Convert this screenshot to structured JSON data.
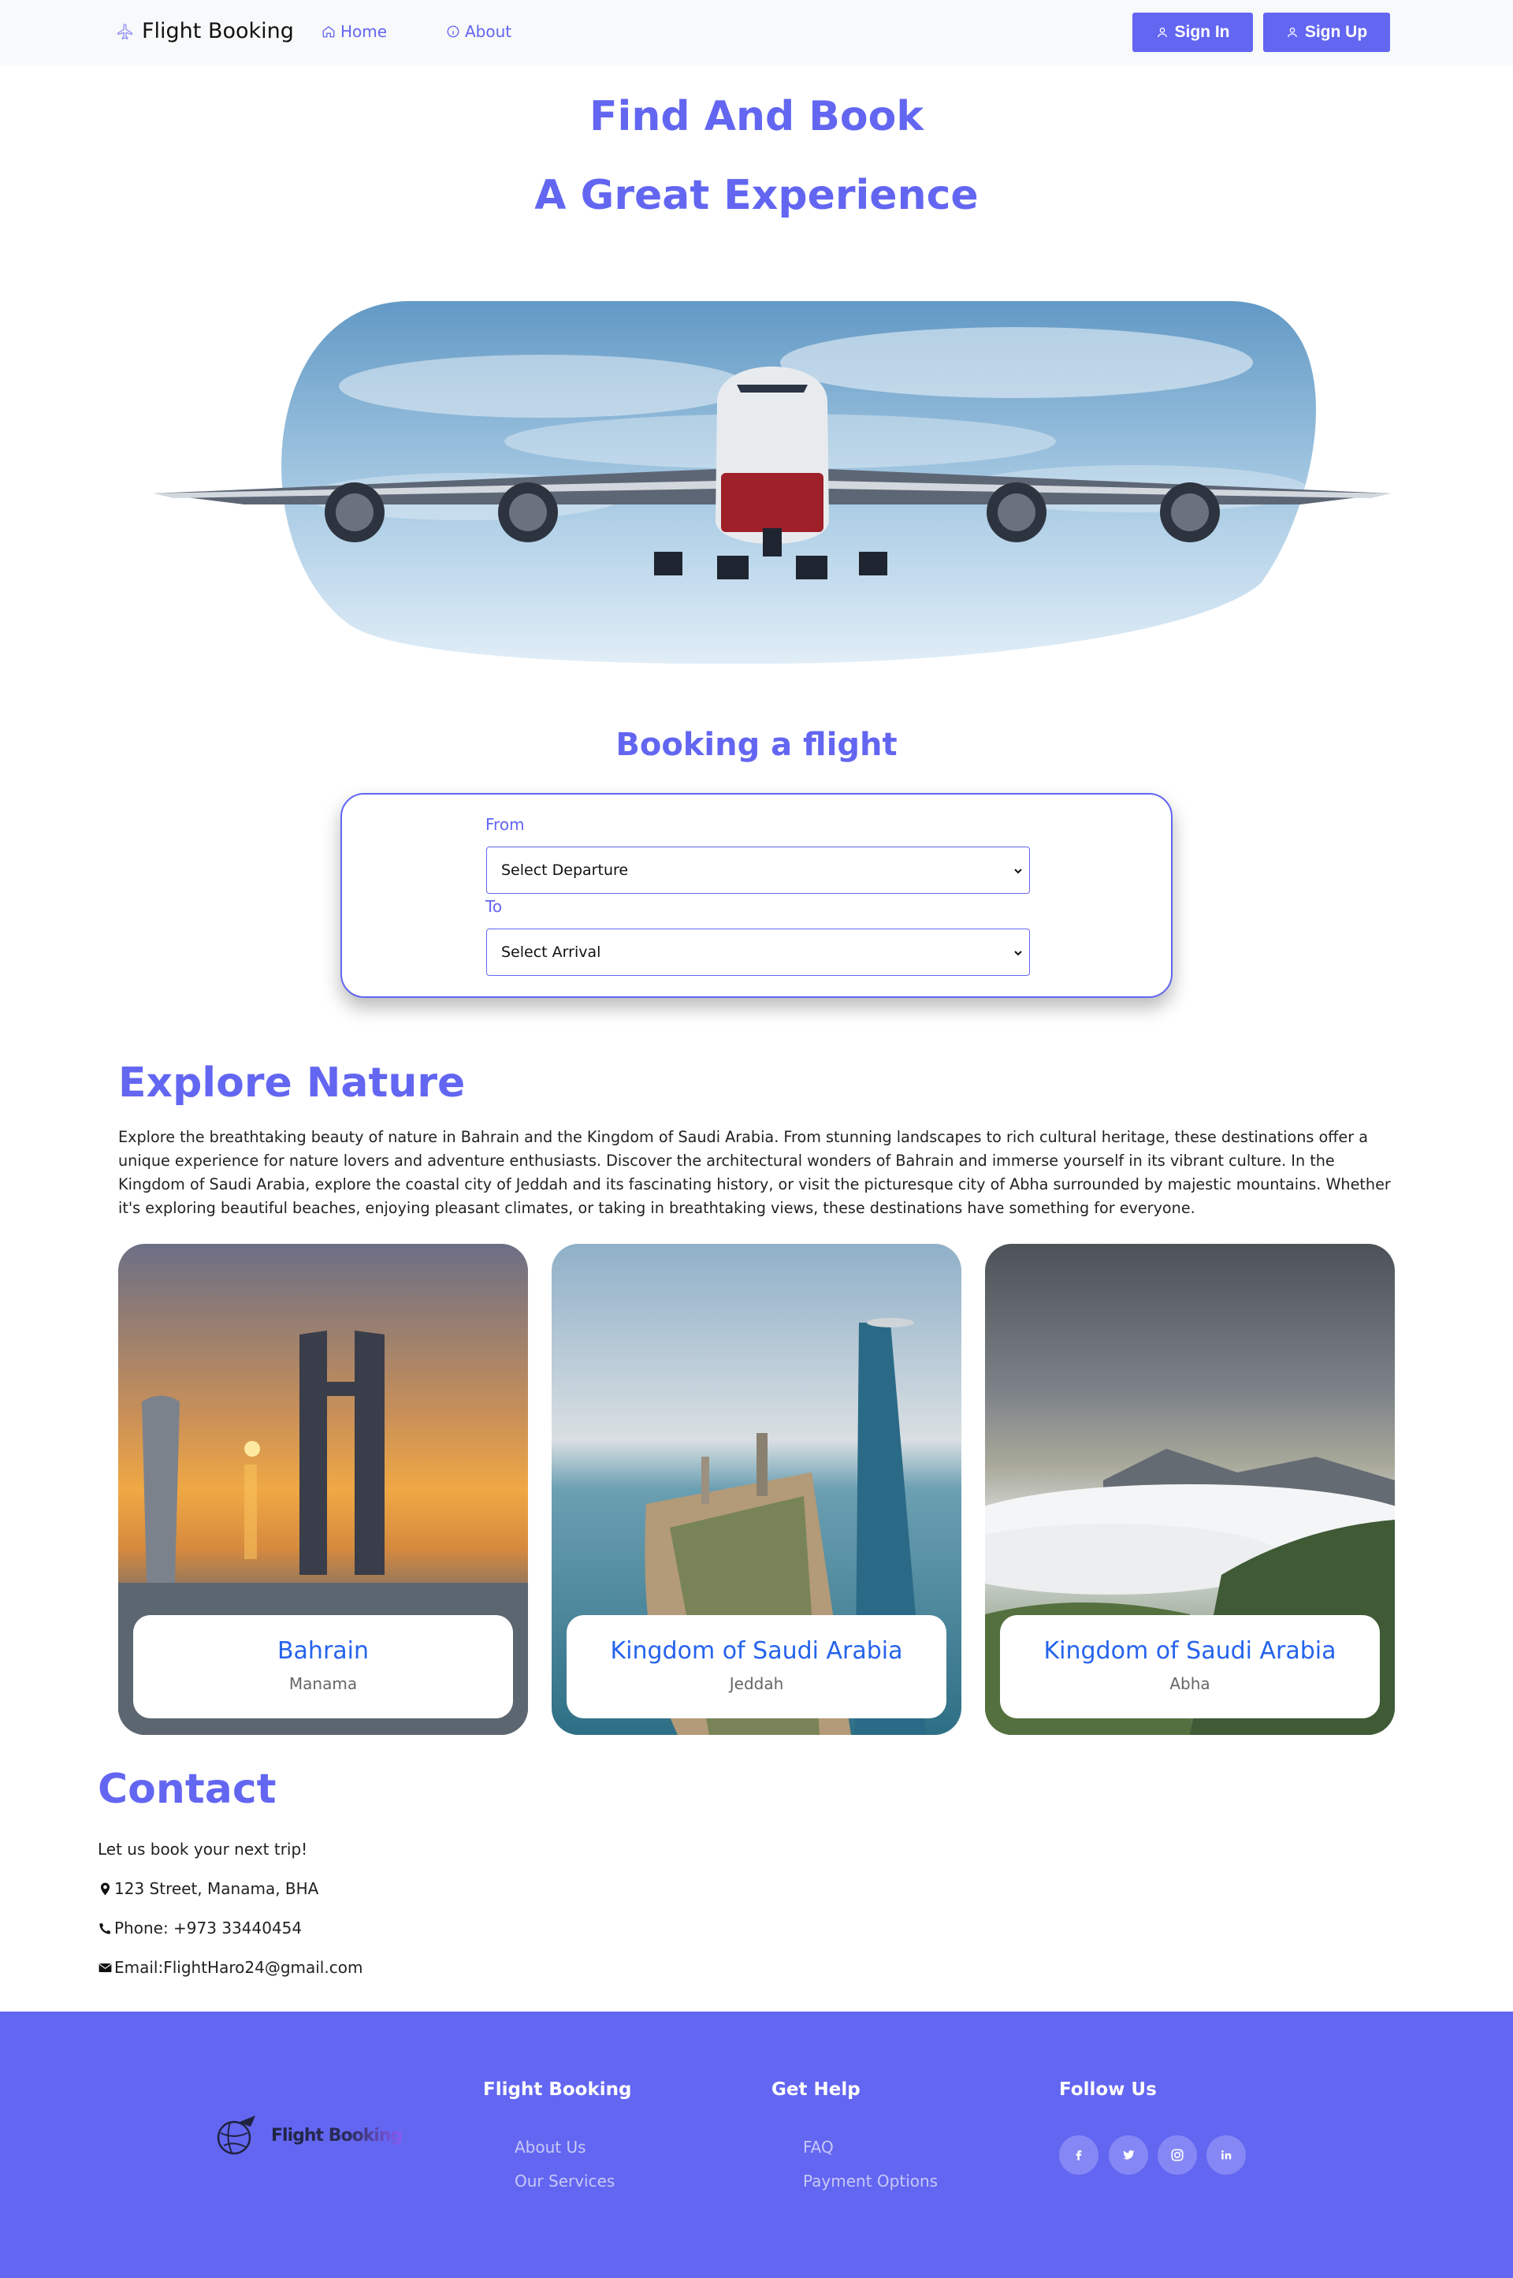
{
  "navbar": {
    "brand": "Flight Booking",
    "home_label": "Home",
    "about_label": "About",
    "signin_label": "Sign In",
    "signup_label": "Sign Up"
  },
  "hero": {
    "title_line1": "Find And Book",
    "title_line2": "A Great Experience"
  },
  "booking": {
    "title": "Booking a flight",
    "from_label": "From",
    "from_value": "Select Departure",
    "to_label": "To",
    "to_value": "Select Arrival"
  },
  "explore": {
    "title": "Explore Nature",
    "text": "Explore the breathtaking beauty of nature in Bahrain and the Kingdom of Saudi Arabia. From stunning landscapes to rich cultural heritage, these destinations offer a unique experience for nature lovers and adventure enthusiasts. Discover the architectural wonders of Bahrain and immerse yourself in its vibrant culture. In the Kingdom of Saudi Arabia, explore the coastal city of Jeddah and its fascinating history, or visit the picturesque city of Abha surrounded by majestic mountains. Whether it's exploring beautiful beaches, enjoying pleasant climates, or taking in breathtaking views, these destinations have something for everyone.",
    "destinations": [
      {
        "name": "Bahrain",
        "city": "Manama"
      },
      {
        "name": "Kingdom of Saudi Arabia",
        "city": "Jeddah"
      },
      {
        "name": "Kingdom of Saudi Arabia",
        "city": "Abha"
      }
    ]
  },
  "contact": {
    "title": "Contact",
    "tagline": "Let us book your next trip!",
    "address": "123 Street, Manama, BHA",
    "phone": "Phone: +973 33440454",
    "email": "Email:FlightHaro24@gmail.com"
  },
  "footer": {
    "logo_text": "Flight Booking",
    "col1_heading": "Flight Booking",
    "col1_links": [
      "About Us",
      "Our Services"
    ],
    "col2_heading": "Get Help",
    "col2_links": [
      "FAQ",
      "Payment Options"
    ],
    "col3_heading": "Follow Us",
    "social": [
      "facebook-icon",
      "twitter-icon",
      "instagram-icon",
      "linkedin-icon"
    ]
  },
  "colors": {
    "accent": "#6366f1",
    "destination_name": "#2563eb"
  }
}
